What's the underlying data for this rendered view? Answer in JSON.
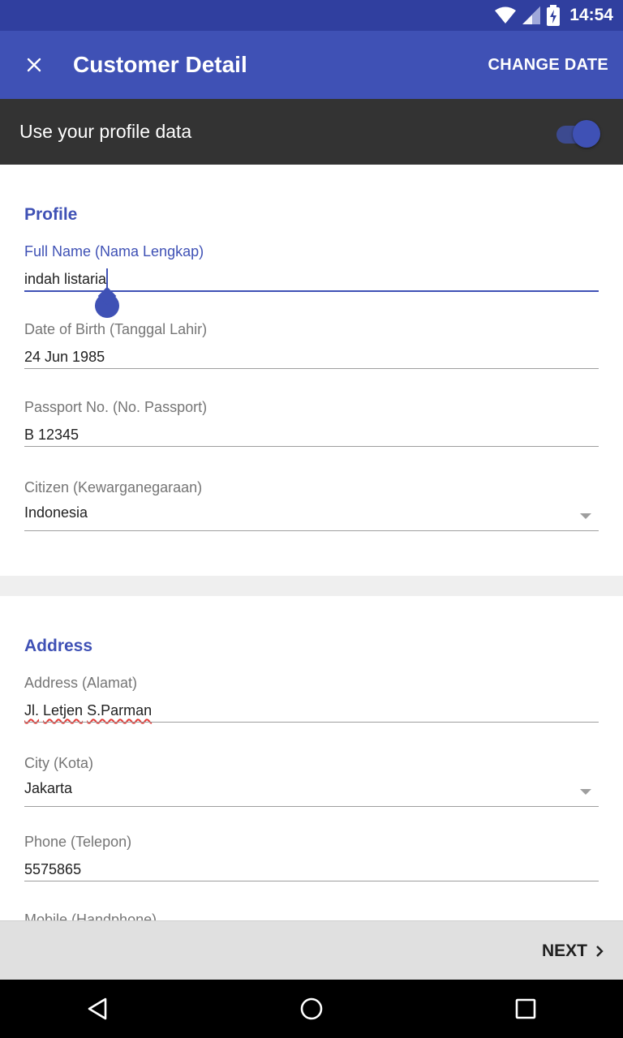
{
  "status_bar": {
    "time": "14:54",
    "icons": [
      "wifi-icon",
      "signal-icon",
      "battery-charging-icon"
    ]
  },
  "app_bar": {
    "close_icon": "close-icon",
    "title": "Customer Detail",
    "action_label": "CHANGE DATE"
  },
  "profile_toggle": {
    "label": "Use your profile data",
    "enabled": true
  },
  "profile": {
    "title": "Profile",
    "full_name": {
      "label": "Full Name (Nama Lengkap)",
      "value": "indah listaria"
    },
    "dob": {
      "label": "Date of Birth (Tanggal Lahir)",
      "value": "24 Jun 1985"
    },
    "passport": {
      "label": "Passport No. (No. Passport)",
      "value": "B 12345"
    },
    "citizen": {
      "label": "Citizen (Kewarganegaraan)",
      "value": "Indonesia"
    }
  },
  "address": {
    "title": "Address",
    "address": {
      "label": "Address (Alamat)",
      "words": [
        "Jl.",
        "Letjen",
        "S.Parman"
      ]
    },
    "city": {
      "label": "City (Kota)",
      "value": "Jakarta"
    },
    "phone": {
      "label": "Phone (Telepon)",
      "value": "5575865"
    },
    "mobile": {
      "label": "Mobile (Handphone)"
    }
  },
  "footer": {
    "next_label": "NEXT",
    "next_icon": "chevron-right-icon"
  },
  "nav_bar": {
    "icons": [
      "back-icon",
      "home-icon",
      "recents-icon"
    ]
  },
  "colors": {
    "primary": "#3f51b5",
    "primary_dark": "#303f9f",
    "toggle_bar": "#333333",
    "error_underline": "#e53935"
  }
}
